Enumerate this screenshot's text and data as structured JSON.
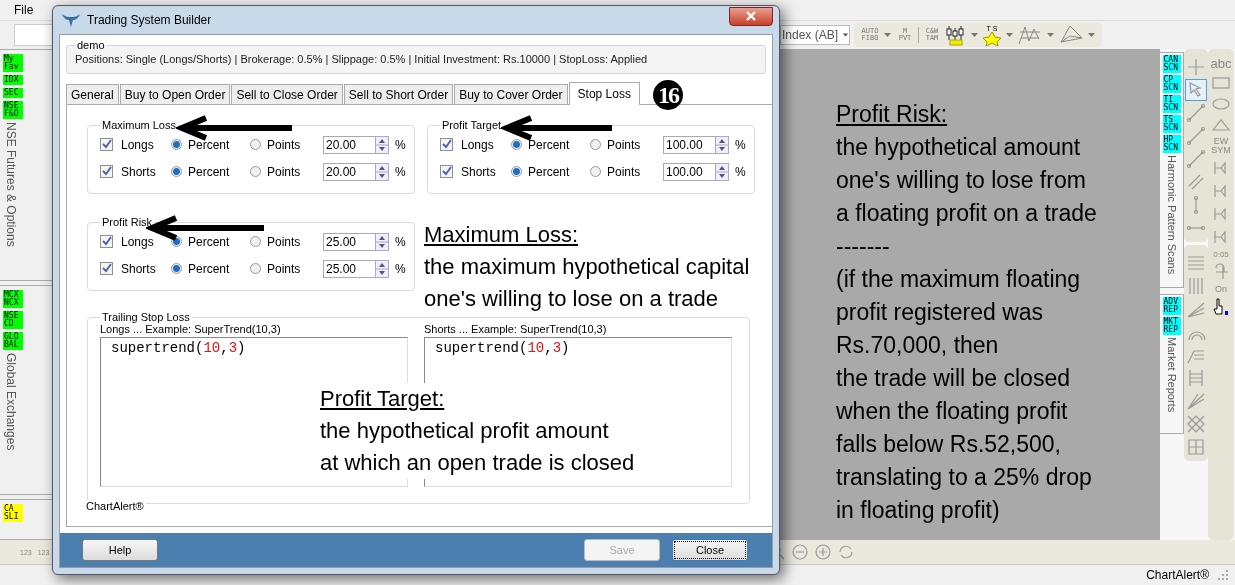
{
  "menu": [
    {
      "label": "File"
    }
  ],
  "toolbar": {
    "symbol_dropdown": "Index (AB]",
    "text_tools": [
      "AUTO FIBO",
      "M PVT",
      "C&W TAM",
      "T S"
    ]
  },
  "left_panel": {
    "sections": [
      {
        "badges": [
          {
            "label": "My Fav",
            "color": "#00ff00"
          },
          {
            "label": "IDX",
            "color": "#00ff00"
          },
          {
            "label": "SEC",
            "color": "#00ff00"
          },
          {
            "label": "NSE F&O",
            "color": "#00ff00"
          }
        ],
        "title": "NSE Futures & Options"
      },
      {
        "badges": [
          {
            "label": "MCX NCX",
            "color": "#00ff00"
          },
          {
            "label": "NSE CD",
            "color": "#00ff00"
          },
          {
            "label": "GLO BAL",
            "color": "#00ff00"
          }
        ],
        "title": "Global Exchanges"
      },
      {
        "badges": [
          {
            "label": "CA SLI",
            "color": "#ffff00"
          }
        ]
      }
    ]
  },
  "right_panel": {
    "sections": [
      {
        "badges": [
          {
            "label": "CAN SCN",
            "color": "#00ffff"
          },
          {
            "label": "CP SCN",
            "color": "#00ffff"
          },
          {
            "label": "TI SCN",
            "color": "#00ffff"
          },
          {
            "label": "TS SCN",
            "color": "#00ffff"
          },
          {
            "label": "HP SCN",
            "color": "#00ffff"
          }
        ],
        "title": "Harmonic Pattern Scans"
      },
      {
        "badges": [
          {
            "label": "ADV REP",
            "color": "#00ffff"
          },
          {
            "label": "MKT REP",
            "color": "#00ffff"
          }
        ],
        "title": "Market Reports"
      }
    ],
    "drawing_tools": [
      {
        "selected": false
      },
      {
        "selected": true
      },
      {
        "selected": false
      },
      {
        "selected": false
      },
      {
        "selected": false
      },
      {
        "selected": false
      },
      {
        "selected": false
      },
      {
        "selected": false
      }
    ],
    "shape_tools": [
      "abc",
      "EW SYM",
      "0:05",
      "On"
    ]
  },
  "bottom_bar": {
    "tools": [
      "123",
      "123"
    ]
  },
  "status_bar": {
    "text": "ChartAlert®"
  },
  "dialog": {
    "title": "Trading System Builder",
    "summary": {
      "title": "demo",
      "text": "Positions: Single (Longs/Shorts) | Brokerage: 0.5% | Slippage: 0.5% | Initial Investment: Rs.10000 | StopLoss: Applied"
    },
    "tabs": [
      {
        "label": "General",
        "selected": false
      },
      {
        "label": "Buy to Open Order",
        "selected": false
      },
      {
        "label": "Sell to Close Order",
        "selected": false
      },
      {
        "label": "Sell to Short Order",
        "selected": false
      },
      {
        "label": "Buy to Cover Order",
        "selected": false
      },
      {
        "label": "Stop Loss",
        "selected": true
      }
    ],
    "groups": [
      {
        "title": "Maximum Loss",
        "rows": [
          {
            "label": "Longs",
            "checked": true,
            "options": [
              {
                "label": "Percent",
                "selected": true
              },
              {
                "label": "Points",
                "selected": false
              }
            ],
            "value": "20.00",
            "unit": "%"
          },
          {
            "label": "Shorts",
            "checked": true,
            "options": [
              {
                "label": "Percent",
                "selected": true
              },
              {
                "label": "Points",
                "selected": false
              }
            ],
            "value": "20.00",
            "unit": "%"
          }
        ]
      },
      {
        "title": "Profit Target",
        "rows": [
          {
            "label": "Longs",
            "checked": true,
            "options": [
              {
                "label": "Percent",
                "selected": true
              },
              {
                "label": "Points",
                "selected": false
              }
            ],
            "value": "100.00",
            "unit": "%"
          },
          {
            "label": "Shorts",
            "checked": true,
            "options": [
              {
                "label": "Percent",
                "selected": true
              },
              {
                "label": "Points",
                "selected": false
              }
            ],
            "value": "100.00",
            "unit": "%"
          }
        ]
      },
      {
        "title": "Profit Risk",
        "rows": [
          {
            "label": "Longs",
            "checked": true,
            "options": [
              {
                "label": "Percent",
                "selected": true
              },
              {
                "label": "Points",
                "selected": false
              }
            ],
            "value": "25.00",
            "unit": "%"
          },
          {
            "label": "Shorts",
            "checked": true,
            "options": [
              {
                "label": "Percent",
                "selected": true
              },
              {
                "label": "Points",
                "selected": false
              }
            ],
            "value": "25.00",
            "unit": "%"
          }
        ]
      }
    ],
    "trailing_stop": {
      "title": "Trailing Stop Loss",
      "editors": [
        {
          "label": "Longs ... Example: SuperTrend(10,3)",
          "code": "supertrend(10,3)"
        },
        {
          "label": "Shorts ... Example: SuperTrend(10,3)",
          "code": "supertrend(10,3)"
        }
      ]
    },
    "footer_label": "ChartAlert®",
    "buttons": [
      {
        "label": "Help",
        "disabled": false,
        "focused": false
      },
      {
        "label": "Save",
        "disabled": true,
        "focused": false
      },
      {
        "label": "Close",
        "disabled": false,
        "focused": true
      }
    ]
  },
  "step_badge": "16",
  "annotations": [
    {
      "title": "Maximum Loss:",
      "lines": [
        "the maximum hypothetical capital",
        "one's willing to lose on a trade"
      ]
    },
    {
      "title": "Profit Target:",
      "lines": [
        "the hypothetical profit amount",
        "at which an open trade is closed"
      ]
    },
    {
      "title": "Profit Risk:",
      "lines": [
        "the hypothetical amount",
        "one's willing to lose from",
        "a floating profit on a trade",
        "-------",
        "(if the maximum floating",
        "profit registered was",
        "Rs.70,000, then",
        "the trade will be closed",
        "when the floating profit",
        "falls below Rs.52,500,",
        "translating to a 25% drop",
        "in floating profit)"
      ]
    }
  ]
}
